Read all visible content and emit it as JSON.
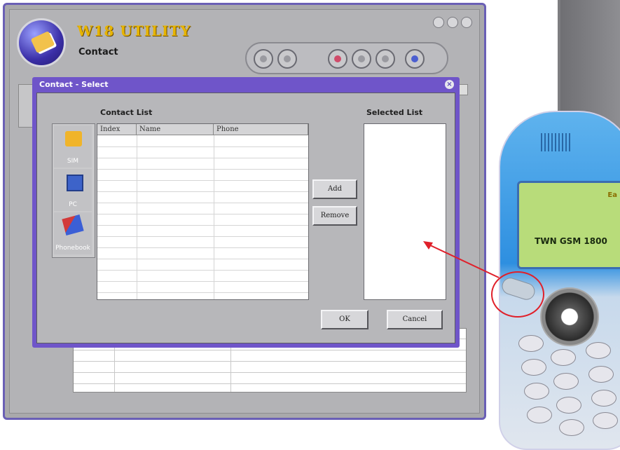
{
  "app": {
    "brand": "W18 UTILITY",
    "section": "Contact"
  },
  "dialog": {
    "title": "Contact - Select",
    "contact_list_label": "Contact List",
    "selected_list_label": "Selected List",
    "columns": [
      "Index",
      "Name",
      "Phone"
    ],
    "side_buttons": [
      "SIM",
      "PC",
      "Phonebook"
    ],
    "add_label": "Add",
    "remove_label": "Remove",
    "ok_label": "OK",
    "cancel_label": "Cancel"
  },
  "phone": {
    "screen_text": "TWN GSM 1800",
    "signal_text": "Ea"
  },
  "colors": {
    "accent": "#6f55c9",
    "brand_gold": "#e7b400",
    "highlight_red": "#e0202a"
  }
}
